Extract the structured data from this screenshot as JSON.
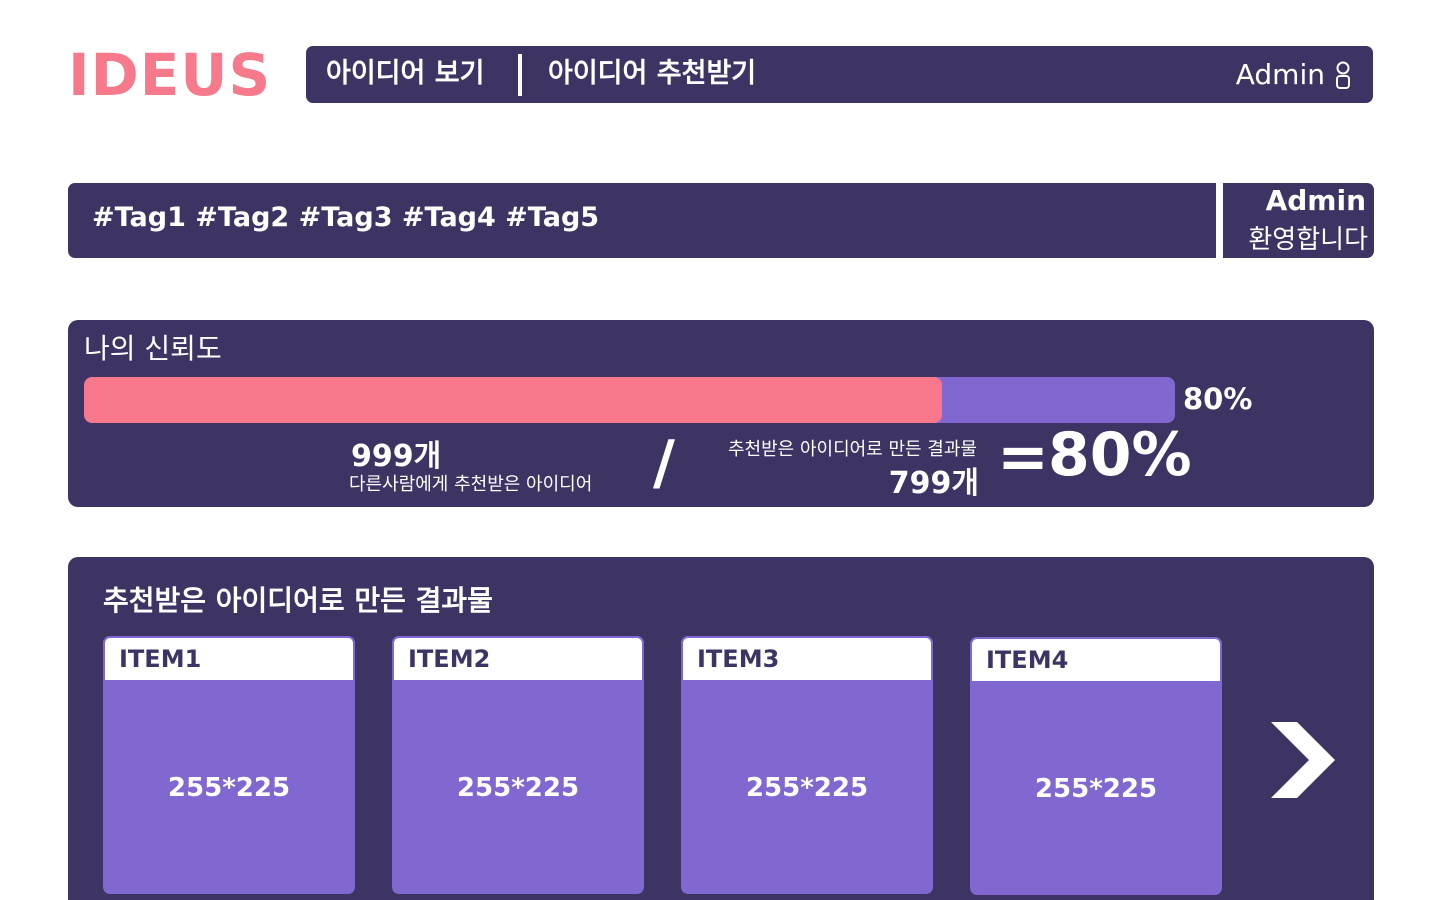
{
  "brand": {
    "logo": "IDEUS"
  },
  "nav": {
    "view_ideas": "아이디어 보기",
    "recommended": "아이디어 추천받기",
    "user": "Admin",
    "user_icon": "user-icon"
  },
  "tags": {
    "text": "#Tag1 #Tag2 #Tag3 #Tag4 #Tag5"
  },
  "welcome": {
    "name": "Admin",
    "message": "환영합니다"
  },
  "trust": {
    "title": "나의 신뢰도",
    "percent_label": "80%",
    "fill_fraction": 0.786,
    "recommended_count": "999개",
    "recommended_caption": "다른사람에게 추천받은 아이디어",
    "slash": "/",
    "made_caption": "추천받은 아이디어로 만든 결과물",
    "made_count": "799개",
    "equals": "=",
    "result": "80%"
  },
  "results": {
    "title": "추천받은 아이디어로 만든 결과물",
    "items": [
      {
        "label": "ITEM1",
        "placeholder": "255*225"
      },
      {
        "label": "ITEM2",
        "placeholder": "255*225"
      },
      {
        "label": "ITEM3",
        "placeholder": "255*225"
      },
      {
        "label": "ITEM4",
        "placeholder": "255*225"
      }
    ],
    "next_icon": "chevron-right-icon"
  },
  "colors": {
    "navy": "#3e3464",
    "pink": "#f6788a",
    "purple": "#8167d0",
    "white": "#ffffff"
  }
}
